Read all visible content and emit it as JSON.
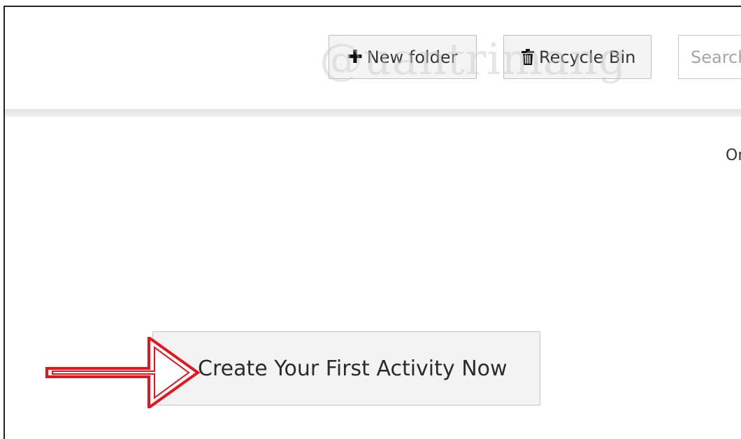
{
  "toolbar": {
    "new_folder_label": "New folder",
    "recycle_bin_label": "Recycle Bin",
    "search_placeholder": "Search",
    "new_folder_icon": "plus-icon",
    "recycle_bin_icon": "trash-icon"
  },
  "watermark": {
    "text": "@uantrimang"
  },
  "main": {
    "right_cut_text": "Or",
    "create_button_label": "Create Your First Activity Now"
  },
  "annotation": {
    "arrow_color": "#e8141b",
    "arrow_icon": "right-arrow-icon"
  }
}
